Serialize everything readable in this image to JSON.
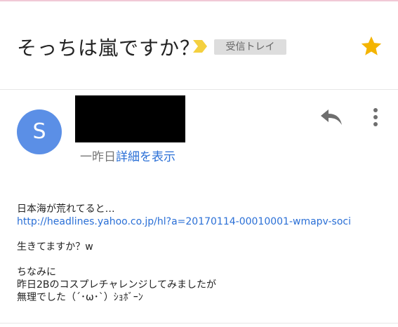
{
  "email": {
    "subject": "そっちは嵐ですか？",
    "label": "受信トレイ",
    "sender_initial": "S",
    "date": "一昨日",
    "details_link": "詳細を表示"
  },
  "body_lines": {
    "line1": "日本海が荒れてると…",
    "link": "http://headlines.yahoo.co.jp/hl?a=20170114-00010001-wmapv-soci",
    "line3": "生きてますか？w",
    "line4": "ちなみに",
    "line5": "昨日2Bのコスプレチャレンジしてみましたが",
    "line6": "無理でした（´･ω･`）ｼｮﾎﾞｰﾝ"
  },
  "icons": {
    "importance": "importance-marker-icon",
    "star": "star-icon",
    "reply": "reply-icon",
    "more": "more-vert-icon"
  },
  "colors": {
    "star": "#f4b400",
    "importance": "#f4d03f",
    "avatar": "#5b8fe6",
    "link": "#2a6fd6"
  }
}
